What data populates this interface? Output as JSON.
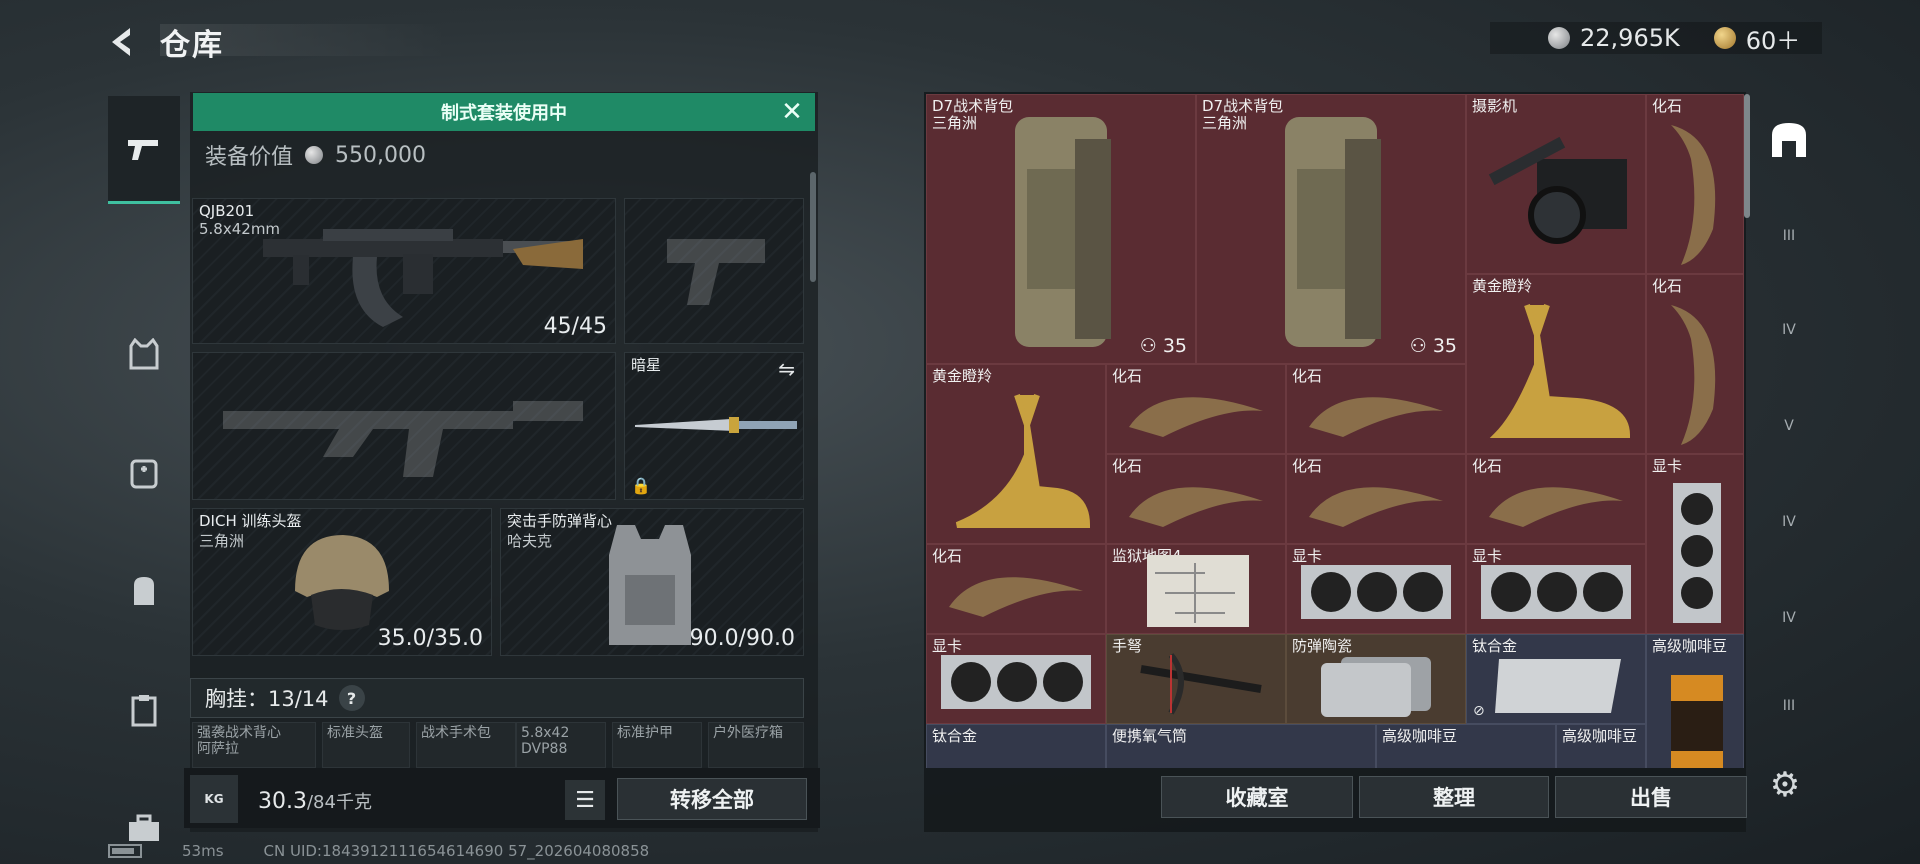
{
  "header": {
    "title": "仓库",
    "currency": [
      {
        "icon": "silver-coin-icon",
        "value": "22,965K"
      },
      {
        "icon": "gold-coin-icon",
        "value": "60＋"
      }
    ]
  },
  "left_rail": {
    "items": [
      {
        "icon": "pistol-icon",
        "active": true
      },
      {
        "icon": "vest-icon",
        "active": false
      },
      {
        "icon": "medkit-icon",
        "active": false
      },
      {
        "icon": "backpack-icon",
        "active": false
      },
      {
        "icon": "clipboard-icon",
        "active": false
      },
      {
        "icon": "toolbox-icon",
        "active": false
      }
    ]
  },
  "loadout": {
    "banner": "制式套装使用中",
    "equip_value_label": "装备价值",
    "equip_value": "550,000",
    "primary": {
      "name": "QJB201",
      "ammo": "5.8x42mm",
      "durability": "45/45"
    },
    "melee": {
      "name": "暗星"
    },
    "helmet": {
      "name": "DICH 训练头盔",
      "sub": "三角洲",
      "durability": "35.0/35.0"
    },
    "armor": {
      "name": "突击手防弹背心",
      "sub": "哈夫克",
      "durability": "90.0/90.0"
    },
    "rig_label": "胸挂：13/14",
    "rig_help": "?",
    "mini_slots": [
      {
        "line1": "强袭战术背心",
        "line2": "阿萨拉"
      },
      {
        "line1": "标准头盔",
        "line2": ""
      },
      {
        "line1": "战术手术包",
        "line2": ""
      },
      {
        "line1": "5.8x42",
        "line2": "DVP88"
      },
      {
        "line1": "标准护甲",
        "line2": ""
      },
      {
        "line1": "户外医疗箱",
        "line2": ""
      }
    ],
    "weight_icon": "KG",
    "weight_current": "30.3",
    "weight_max": "/84千克",
    "transfer_all": "转移全部"
  },
  "storage": {
    "items": [
      {
        "label": "D7战术背包",
        "sub": "三角洲",
        "count": "35"
      },
      {
        "label": "D7战术背包",
        "sub": "三角洲",
        "count": "35"
      },
      {
        "label": "摄影机"
      },
      {
        "label": "化石"
      },
      {
        "label": "黄金瞪羚"
      },
      {
        "label": "化石"
      },
      {
        "label": "黄金瞪羚"
      },
      {
        "label": "化石"
      },
      {
        "label": "化石"
      },
      {
        "label": "化石"
      },
      {
        "label": "化石"
      },
      {
        "label": "化石"
      },
      {
        "label": "显卡"
      },
      {
        "label": "化石"
      },
      {
        "label": "监狱地图4"
      },
      {
        "label": "显卡"
      },
      {
        "label": "显卡"
      },
      {
        "label": "显卡"
      },
      {
        "label": "手弩"
      },
      {
        "label": "防弹陶瓷"
      },
      {
        "label": "钛合金"
      },
      {
        "label": "高级咖啡豆"
      },
      {
        "label": "钛合金"
      },
      {
        "label": "便携氧气筒"
      },
      {
        "label": "高级咖啡豆"
      },
      {
        "label": "高级咖啡豆"
      }
    ],
    "buttons": {
      "collection": "收藏室",
      "sort": "整理",
      "sell": "出售"
    }
  },
  "right_rail": {
    "items": [
      "home-base-icon",
      "III",
      "IV",
      "V",
      "IV",
      "IV",
      "III"
    ]
  },
  "status": {
    "ping": "53ms",
    "uid": "CN UID:1843912111654614690 57_202604080858"
  }
}
